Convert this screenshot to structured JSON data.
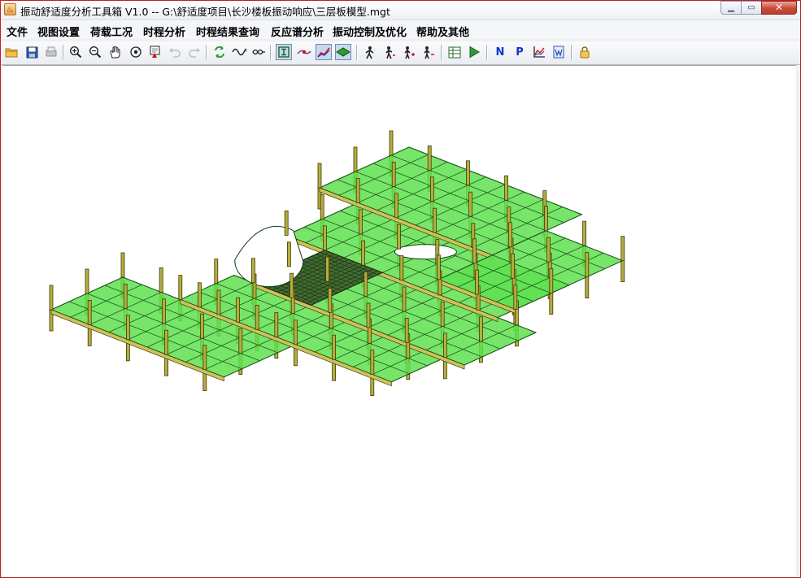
{
  "window": {
    "title": "振动舒适度分析工具箱 V1.0 -- G:\\舒适度项目\\长沙楼板振动响应\\三层板模型.mgt"
  },
  "menu": {
    "items": [
      "文件",
      "视图设置",
      "荷载工况",
      "时程分析",
      "时程结果查询",
      "反应谱分析",
      "振动控制及优化",
      "帮助及其他"
    ]
  },
  "toolbar": {
    "buttons": [
      {
        "icon": "open-folder-icon"
      },
      {
        "icon": "save-icon"
      },
      {
        "icon": "print-icon"
      },
      {
        "icon": "zoom-in-icon"
      },
      {
        "icon": "zoom-out-icon"
      },
      {
        "icon": "pan-hand-icon"
      },
      {
        "icon": "rotate-view-icon"
      },
      {
        "icon": "fit-view-icon"
      },
      {
        "icon": "undo-icon"
      },
      {
        "icon": "redo-icon"
      },
      {
        "icon": "refresh-icon"
      },
      {
        "icon": "sine-wave-icon"
      },
      {
        "icon": "loop-icon"
      },
      {
        "icon": "beam-section-icon"
      },
      {
        "icon": "node-curve-icon"
      },
      {
        "icon": "line-chart-icon"
      },
      {
        "icon": "plate-icon"
      },
      {
        "icon": "walker-1-icon"
      },
      {
        "icon": "walker-2-icon"
      },
      {
        "icon": "walker-add-icon"
      },
      {
        "icon": "walker-remove-icon"
      },
      {
        "icon": "table-icon"
      },
      {
        "icon": "run-icon"
      },
      {
        "icon": "n-letter-icon",
        "label": "N"
      },
      {
        "icon": "p-letter-icon",
        "label": "P"
      },
      {
        "icon": "result-chart-icon"
      },
      {
        "icon": "report-icon"
      },
      {
        "icon": "lock-icon"
      }
    ]
  },
  "colors": {
    "accent_border": "#c8191e",
    "plate_green": "#5fe050",
    "column_olive": "#b6ae3a"
  }
}
